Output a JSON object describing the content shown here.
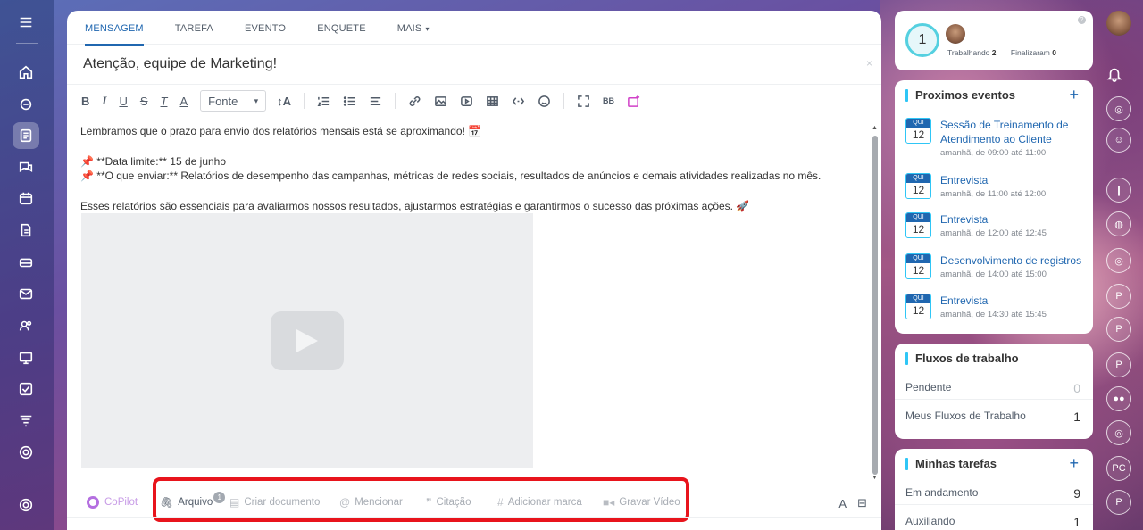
{
  "composer": {
    "tabs": [
      {
        "label": "MENSAGEM"
      },
      {
        "label": "TAREFA"
      },
      {
        "label": "EVENTO"
      },
      {
        "label": "ENQUETE"
      },
      {
        "label": "MAIS"
      }
    ],
    "title": "Atenção, equipe de Marketing!",
    "font_select": "Fonte",
    "body": {
      "line1": "Lembramos que o prazo para envio dos relatórios mensais está se aproximando! 📅",
      "line2": "📌 **Data limite:** 15 de junho",
      "line3": "📌 **O que enviar:** Relatórios de desempenho das campanhas, métricas de redes sociais, resultados de anúncios e demais atividades realizadas no mês.",
      "line4": "Esses relatórios são essenciais para avaliarmos nossos resultados, ajustarmos estratégias e garantirmos o sucesso das próximas ações. 🚀"
    },
    "bottom": {
      "copilot": "CoPilot",
      "arquivo": "Arquivo",
      "arquivo_badge": "1",
      "criar_documento": "Criar documento",
      "mencionar": "Mencionar",
      "citacao": "Citação",
      "adicionar_marca": "Adicionar marca",
      "gravar_video": "Gravar Vídeo"
    }
  },
  "status_widget": {
    "count": "1",
    "working_label": "Trabalhando",
    "working_value": "2",
    "finished_label": "Finalizaram",
    "finished_value": "0"
  },
  "events_widget": {
    "title": "Proximos eventos",
    "events": [
      {
        "day": "QUI",
        "date": "12",
        "title": "Sessão de Treinamento de Atendimento ao Cliente",
        "time": "amanhã, de 09:00 até 11:00"
      },
      {
        "day": "QUI",
        "date": "12",
        "title": "Entrevista",
        "time": "amanhã, de 11:00 até 12:00"
      },
      {
        "day": "QUI",
        "date": "12",
        "title": "Entrevista",
        "time": "amanhã, de 12:00 até 12:45"
      },
      {
        "day": "QUI",
        "date": "12",
        "title": "Desenvolvimento de registros",
        "time": "amanhã, de 14:00 até 15:00"
      },
      {
        "day": "QUI",
        "date": "12",
        "title": "Entrevista",
        "time": "amanhã, de 14:30 até 15:45"
      }
    ]
  },
  "flows_widget": {
    "title": "Fluxos de trabalho",
    "rows": [
      {
        "label": "Pendente",
        "value": "0"
      },
      {
        "label": "Meus Fluxos de Trabalho",
        "value": "1"
      }
    ]
  },
  "tasks_widget": {
    "title": "Minhas tarefas",
    "rows": [
      {
        "label": "Em andamento",
        "value": "9"
      },
      {
        "label": "Auxiliando",
        "value": "1"
      }
    ]
  },
  "colors": {
    "accent": "#2067b0",
    "highlight": "#e8141c",
    "copilot": "#b46fe0"
  }
}
